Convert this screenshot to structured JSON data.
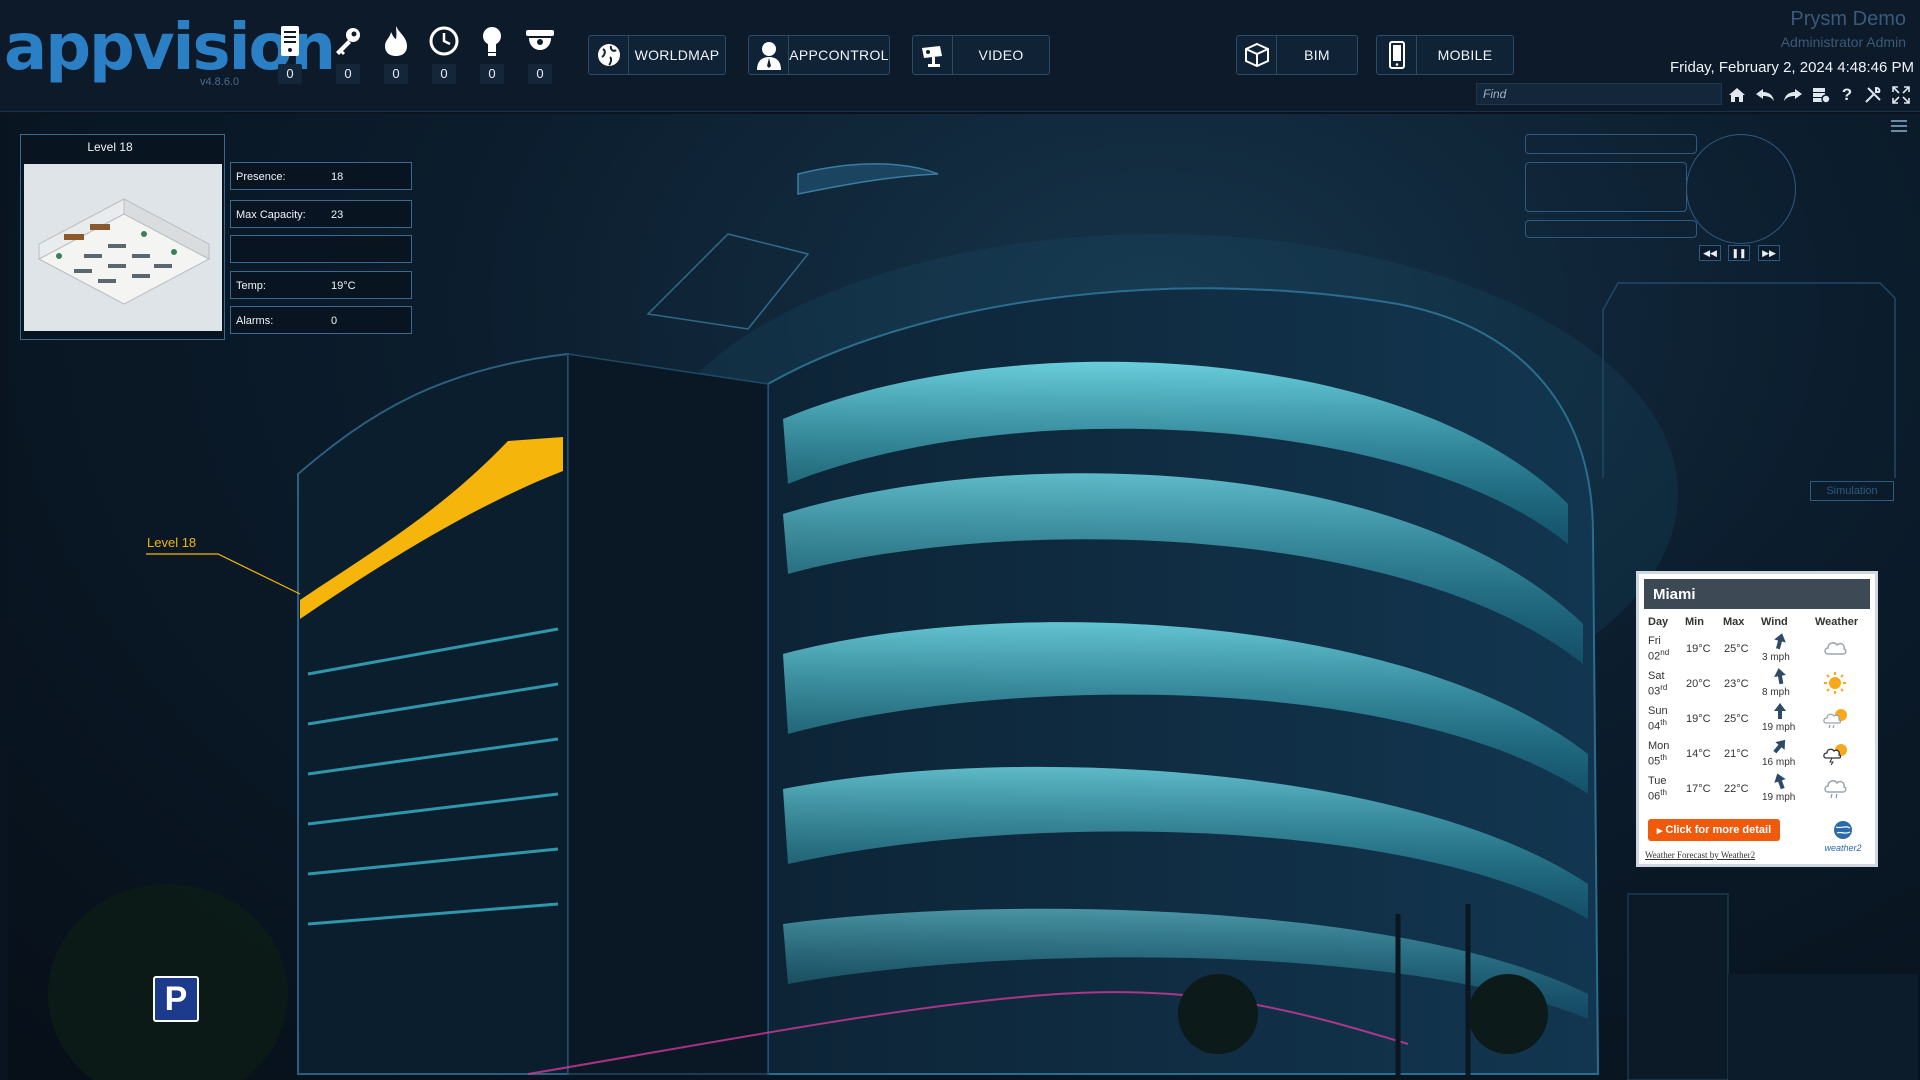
{
  "app": {
    "logo_text": "appvision",
    "version": "v4.8.6.0",
    "brand_title": "Prysm Demo",
    "user": "Administrator Admin",
    "datetime": "Friday, February 2, 2024 4:48:46 PM"
  },
  "counters": [
    {
      "icon": "server-icon",
      "value": "0"
    },
    {
      "icon": "key-icon",
      "value": "0"
    },
    {
      "icon": "fire-icon",
      "value": "0"
    },
    {
      "icon": "clock-icon",
      "value": "0"
    },
    {
      "icon": "lightbulb-icon",
      "value": "0"
    },
    {
      "icon": "dome-camera-icon",
      "value": "0"
    }
  ],
  "nav": {
    "worldmap": "WORLDMAP",
    "appcontrol": "APPCONTROL",
    "video": "VIDEO",
    "bim": "BIM",
    "mobile": "MOBILE"
  },
  "search": {
    "placeholder": "Find"
  },
  "toolbar_icons": [
    "home-icon",
    "undo-icon",
    "redo-icon",
    "database-icon",
    "help-icon",
    "tools-icon",
    "fullscreen-icon"
  ],
  "level_panel": {
    "title": "Level 18",
    "rows": [
      {
        "label": "Presence:",
        "value": "18"
      },
      {
        "label": "Max Capacity:",
        "value": "23"
      },
      {
        "label": "",
        "value": ""
      },
      {
        "label": "Temp:",
        "value": "19°C"
      },
      {
        "label": "Alarms:",
        "value": "0"
      }
    ]
  },
  "callout": {
    "label": "Level 18",
    "color": "#f5b50a"
  },
  "media": {
    "rewind": "◀◀",
    "pause": "❚❚",
    "forward": "▶▶"
  },
  "simulation": {
    "label": "Simulation"
  },
  "weather": {
    "city": "Miami",
    "headers": {
      "day": "Day",
      "min": "Min",
      "max": "Max",
      "wind": "Wind",
      "weather": "Weather"
    },
    "days": [
      {
        "day": "Fri",
        "date": "02",
        "suffix": "nd",
        "min": "19°C",
        "max": "25°C",
        "wind": "3 mph",
        "icon": "cloud"
      },
      {
        "day": "Sat",
        "date": "03",
        "suffix": "rd",
        "min": "20°C",
        "max": "23°C",
        "wind": "8 mph",
        "icon": "sun"
      },
      {
        "day": "Sun",
        "date": "04",
        "suffix": "th",
        "min": "19°C",
        "max": "25°C",
        "wind": "19 mph",
        "icon": "sun-cloud-rain"
      },
      {
        "day": "Mon",
        "date": "05",
        "suffix": "th",
        "min": "14°C",
        "max": "21°C",
        "wind": "16 mph",
        "icon": "sun-storm"
      },
      {
        "day": "Tue",
        "date": "06",
        "suffix": "th",
        "min": "17°C",
        "max": "22°C",
        "wind": "19 mph",
        "icon": "cloud-rain"
      }
    ],
    "button": "Click for more detail",
    "credit": "Weather Forecast by Weather2",
    "logo": "weather2"
  },
  "parking": {
    "label": "P"
  },
  "colors": {
    "accent": "#2b7fc4",
    "highlight": "#f5b50a",
    "panel_border": "#3a6a90",
    "weather_button": "#f05a0c"
  }
}
